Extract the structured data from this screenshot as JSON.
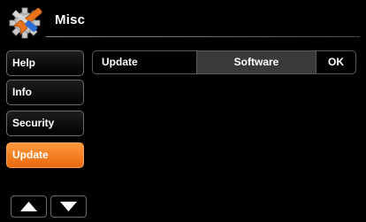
{
  "header": {
    "title": "Misc",
    "logo_icon": "wrench-gear-icon"
  },
  "sidebar": {
    "items": [
      {
        "label": "Help",
        "active": false
      },
      {
        "label": "Info",
        "active": false
      },
      {
        "label": "Security",
        "active": false
      },
      {
        "label": "Update",
        "active": true
      }
    ],
    "scroll_up_icon": "triangle-up-icon",
    "scroll_down_icon": "triangle-down-icon"
  },
  "main": {
    "row": {
      "label": "Update",
      "value": "Software",
      "ok_label": "OK"
    }
  },
  "colors": {
    "accent": "#f07a1e",
    "background": "#000000",
    "border": "#6a6a6a"
  }
}
